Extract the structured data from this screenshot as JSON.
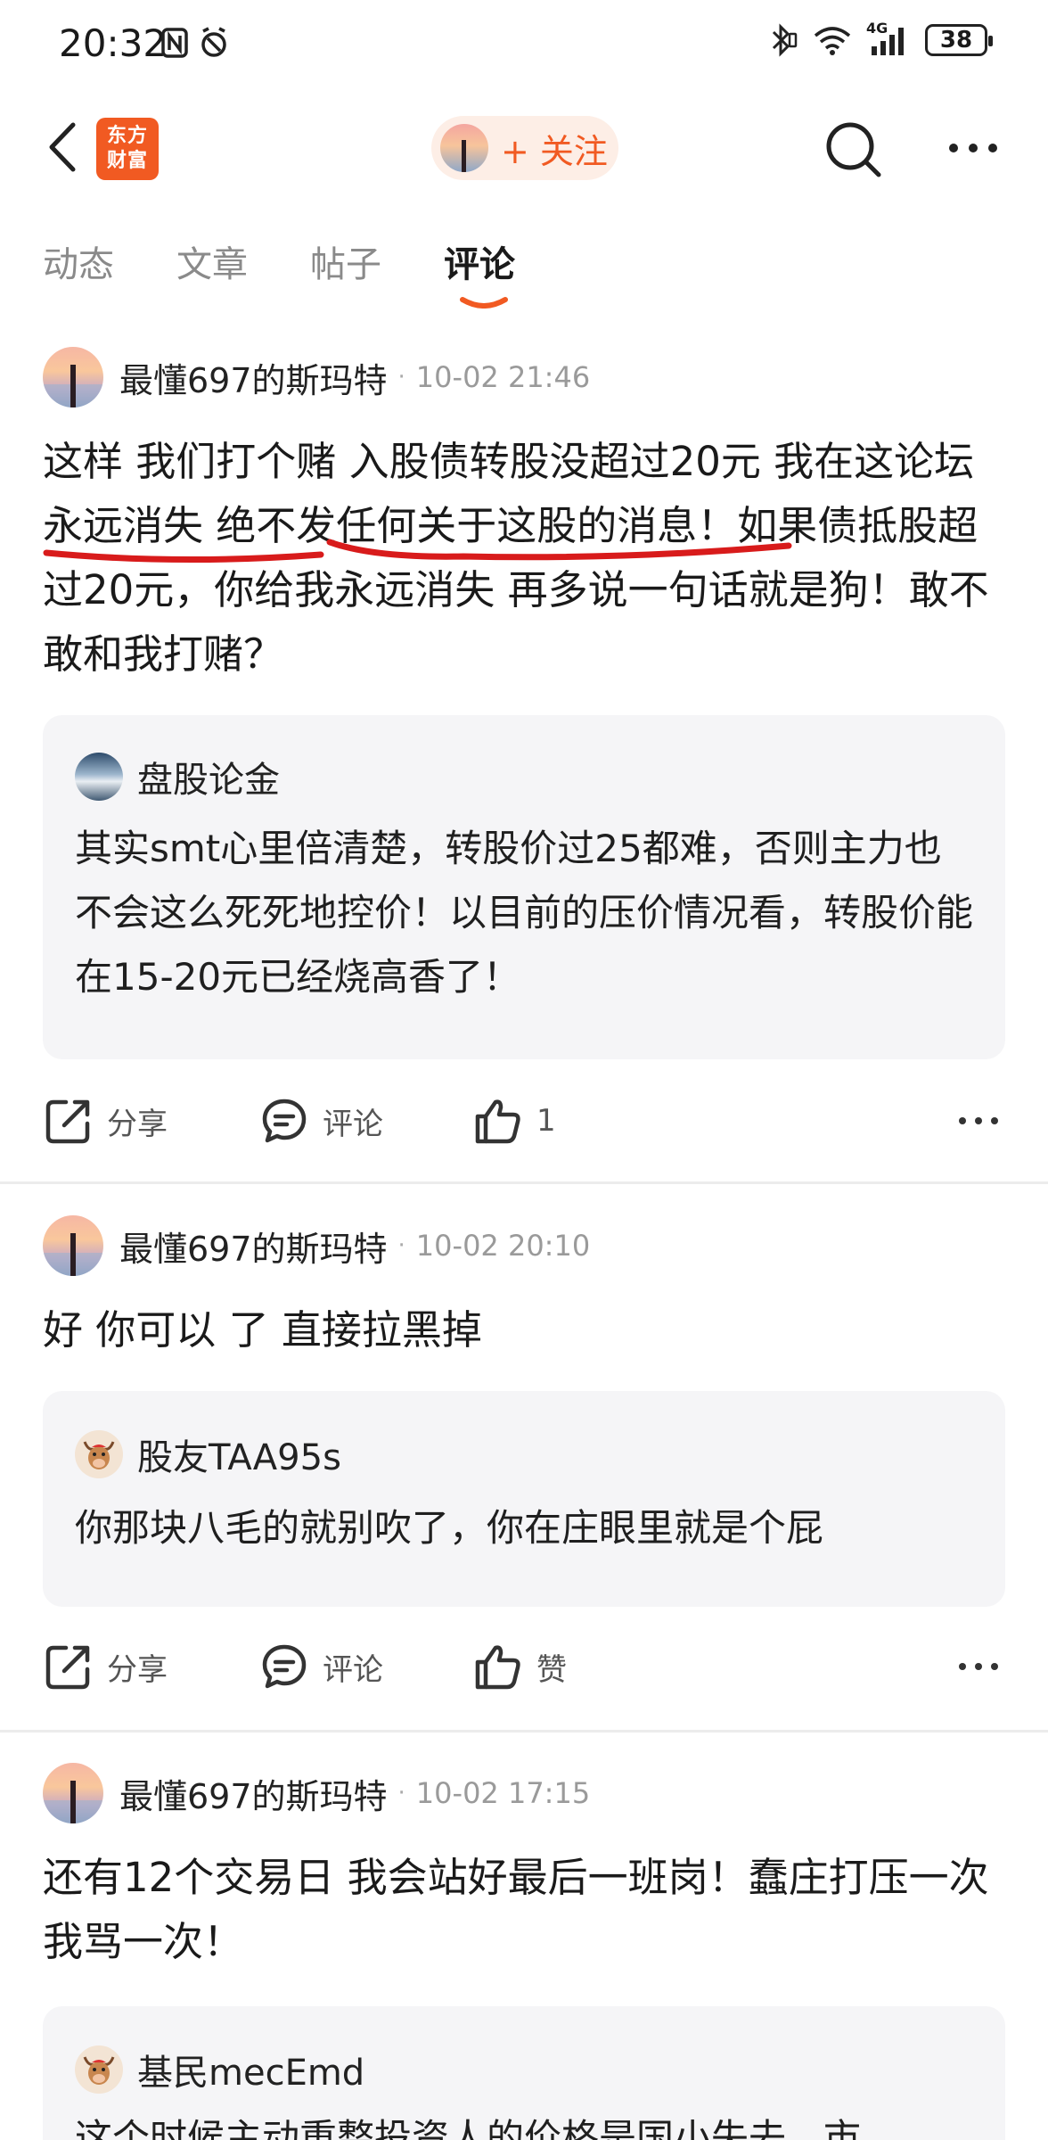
{
  "status_bar": {
    "time": "20:32",
    "network": "4G",
    "battery": "38",
    "icons": [
      "nfc-icon",
      "alarm-icon",
      "bluetooth-icon",
      "wifi-icon",
      "signal-icon",
      "battery-icon"
    ]
  },
  "nav": {
    "logo_line1": "东方",
    "logo_line2": "财富",
    "follow_label": "+ 关注",
    "accent_color": "#f15a22"
  },
  "tabs": [
    {
      "label": "动态",
      "active": false
    },
    {
      "label": "文章",
      "active": false
    },
    {
      "label": "帖子",
      "active": false
    },
    {
      "label": "评论",
      "active": true
    }
  ],
  "posts": [
    {
      "author": "最懂697的斯玛特",
      "time": "10-02 21:46",
      "body": "这样 我们打个赌 入股债转股没超过20元 我在这论坛永远消失 绝不发任何关于这股的消息！如果债抵股超过20元，你给我永远消失 再多说一句话就是狗！敢不敢和我打赌？",
      "quote_author": "盘股论金",
      "quote_text": "其实smt心里倍清楚，转股价过25都难，否则主力也不会这么死死地控价！以目前的压价情况看，转股价能在15-20元已经烧高香了！",
      "share": "分享",
      "comment": "评论",
      "like": "1"
    },
    {
      "author": "最懂697的斯玛特",
      "time": "10-02 20:10",
      "body": "好 你可以 了 直接拉黑掉",
      "quote_author": "股友TAA95s",
      "quote_text": "你那块八毛的就别吹了，你在庄眼里就是个屁",
      "share": "分享",
      "comment": "评论",
      "like": "赞"
    },
    {
      "author": "最懂697的斯玛特",
      "time": "10-02 17:15",
      "body": "还有12个交易日 我会站好最后一班岗！蠢庄打压一次 我骂一次！",
      "quote_author": "基民mecEmd",
      "quote_text": "这个时候主动重整投资人的价格是国小失去，市"
    }
  ]
}
